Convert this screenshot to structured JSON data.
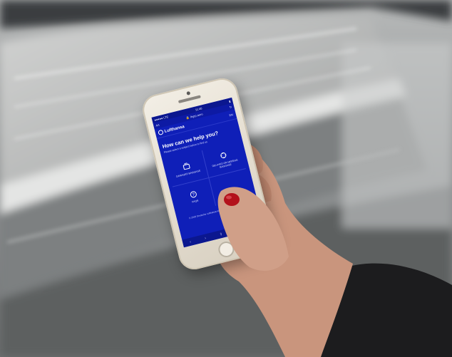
{
  "phone_ui": {
    "status_bar": {
      "carrier": "●●●●● LTE",
      "time": "11:40",
      "battery": "▮"
    },
    "url_bar": {
      "back": "AA",
      "url": "🔒 lhgrp.aero",
      "reload": "↻"
    },
    "app_bar": {
      "brand_name": "Lufthansa",
      "language": "EN"
    },
    "heading": "How can we help you?",
    "subheading": "Please select a subject below to find us",
    "tiles": [
      {
        "label": "DAMAGED BAGGAGE",
        "icon": "suitcase-icon"
      },
      {
        "label": "DELAYED OR MISSING BAGGAGE",
        "icon": "baggage-search-icon"
      },
      {
        "label": "FAQS",
        "icon": "question-icon"
      },
      {
        "label": "",
        "icon": ""
      }
    ],
    "footer": "© 2018 Deutsche Lufthansa AG · Imprint · Data Protection",
    "toolbar": {
      "back": "‹",
      "forward": "›",
      "share": "⇪",
      "bookmarks": "▭",
      "tabs": "❐"
    }
  },
  "colors": {
    "screen_blue": "#0f1fb8",
    "phone_gold": "#e6dfd2",
    "nail_red": "#b3121b"
  }
}
